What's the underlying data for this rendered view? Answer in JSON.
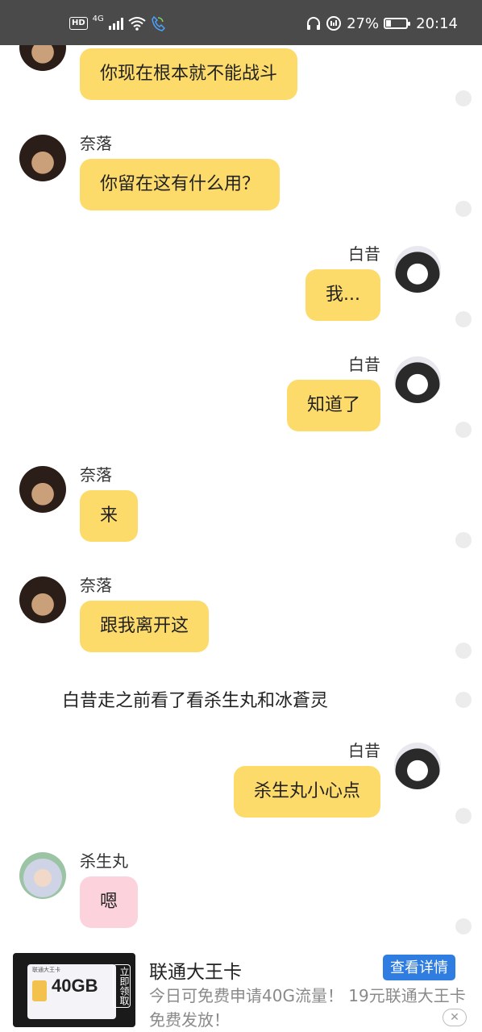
{
  "status_bar": {
    "network": "4G",
    "battery_percent": "27%",
    "battery_level": 0.27,
    "time": "20:14",
    "icons": [
      "hd-icon",
      "signal-icon",
      "wifi-icon",
      "call-icon",
      "headphones-icon",
      "data-saver-icon",
      "battery-icon"
    ]
  },
  "chat": {
    "messages": [
      {
        "type": "received",
        "sender": "",
        "text": "你现在根本就不能战斗",
        "bubble_color": "#fddb6b"
      },
      {
        "type": "received",
        "sender": "奈落",
        "text": "你留在这有什么用？",
        "bubble_color": "#fddb6b"
      },
      {
        "type": "sent",
        "sender": "白昔",
        "text": "我...",
        "bubble_color": "#fddb6b"
      },
      {
        "type": "sent",
        "sender": "白昔",
        "text": "知道了",
        "bubble_color": "#fddb6b"
      },
      {
        "type": "received",
        "sender": "奈落",
        "text": "来",
        "bubble_color": "#fddb6b"
      },
      {
        "type": "received",
        "sender": "奈落",
        "text": "跟我离开这",
        "bubble_color": "#fddb6b"
      },
      {
        "type": "narration",
        "text": "白昔走之前看了看杀生丸和冰蒼灵"
      },
      {
        "type": "sent",
        "sender": "白昔",
        "text": "杀生丸小心点",
        "bubble_color": "#fddb6b"
      },
      {
        "type": "received",
        "sender": "杀生丸",
        "text": "嗯",
        "bubble_color": "#fcd2dc"
      }
    ]
  },
  "ad": {
    "image": {
      "card_title": "联通大王卡",
      "capacity": "40GB",
      "vertical_label": "立即领取"
    },
    "title": "联通大王卡",
    "description": "今日可免费申请40G流量！ 19元联通大王卡免费发放！",
    "button_label": "查看详情",
    "close_label": "✕",
    "button_color": "#2f7de1"
  }
}
